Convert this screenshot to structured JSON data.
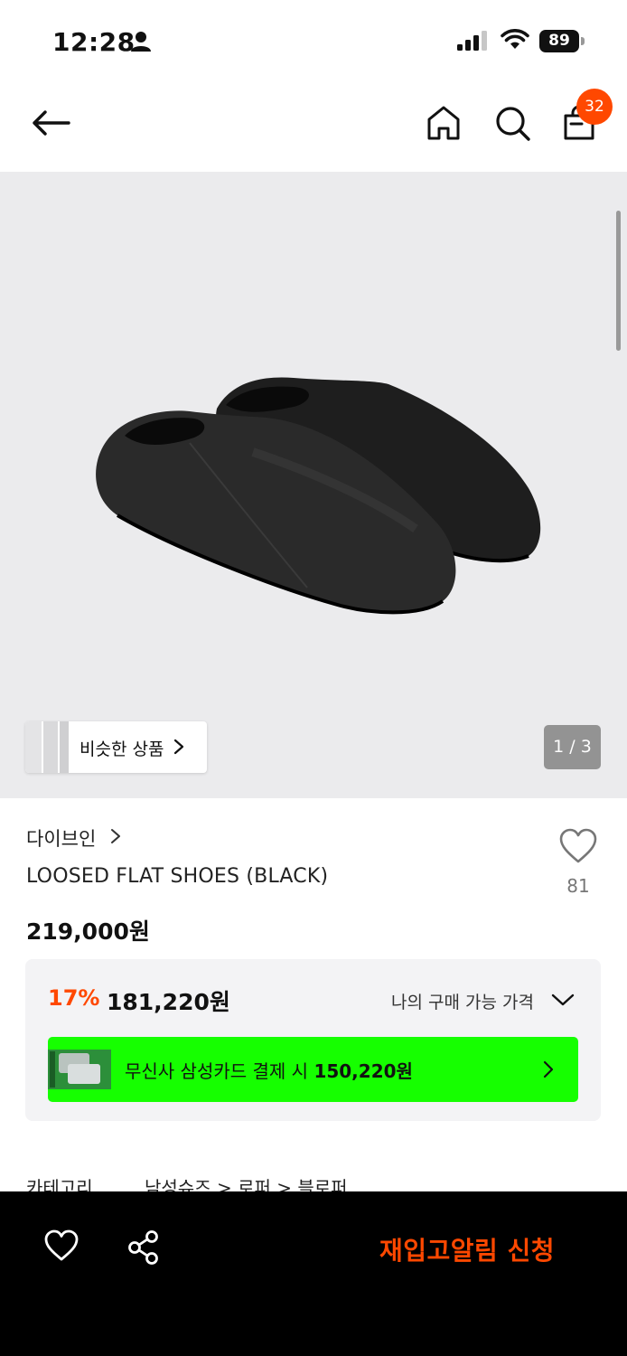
{
  "status_bar": {
    "time": "12:28",
    "battery": "89"
  },
  "nav": {
    "cart_count": "32"
  },
  "gallery": {
    "similar_label": "비슷한 상품",
    "pager": "1 / 3"
  },
  "product": {
    "brand": "다이브인",
    "name": "LOOSED FLAT SHOES (BLACK)",
    "like_count": "81",
    "price": "219,000원"
  },
  "price_box": {
    "discount": "17%",
    "sale_price": "181,220원",
    "my_price_label": "나의 구매 가능 가격",
    "card_banner_prefix": "무신사 삼성카드 결제 시 ",
    "card_banner_price": "150,220원"
  },
  "category": {
    "label": "카테고리",
    "path": "남성슈즈 > 로퍼 > 블로퍼"
  },
  "bottom_bar": {
    "restock_label": "재입고알림 신청"
  },
  "colors": {
    "accent": "#ff4800",
    "banner": "#16ff00"
  }
}
